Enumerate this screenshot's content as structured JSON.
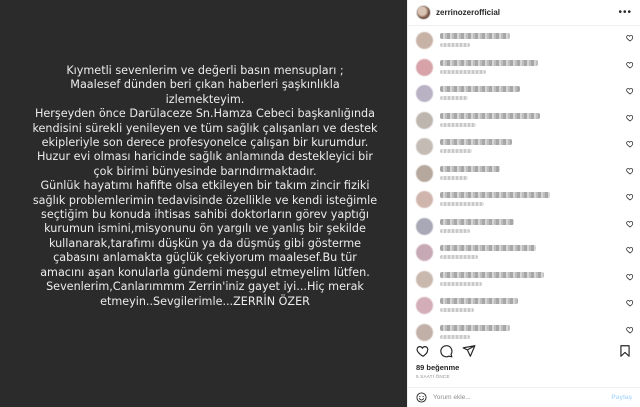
{
  "post": {
    "text_lines": [
      "Kıymetli sevenlerim ve değerli basın mensupları ;",
      "Maalesef dünden beri çıkan haberleri şaşkınlıkla",
      "izlemekteyim.",
      "Herşeyden önce Darülaceze  Sn.Hamza Cebeci başkanlığında",
      "kendisini sürekli yenileyen ve tüm sağlık çalışanları ve destek",
      "ekipleriyle son derece profesyonelce çalışan bir kurumdur.",
      "Huzur evi olması haricinde sağlık anlamında destekleyici bir",
      "çok birimi bünyesinde barındırmaktadır.",
      "Günlük hayatımı hafifte olsa etkileyen bir takım zincir fiziki",
      "sağlık problemlerimin tedavisinde özellikle ve kendi isteğimle",
      "seçtiğim bu konuda ihtisas sahibi doktorların görev yaptığı",
      "kurumun ismini,misyonunu ön yargılı ve yanlış bir şekilde",
      "kullanarak,tarafımı düşkün ya da düşmüş gibi gösterme",
      "çabasını anlamakta güçlük çekiyorum maalesef.Bu tür",
      "amacını aşan  konularla gündemi meşgul etmeyelim lütfen.",
      "Sevenlerim,Canlarımmm Zerrin'iniz gayet iyi...Hiç merak",
      "etmeyin..Sevgilerimle...ZERRİN ÖZER"
    ]
  },
  "header": {
    "username": "zerrinozerofficial",
    "more_icon": "more-horizontal-icon"
  },
  "comments": [
    {
      "text_w": 70,
      "meta_w": 30,
      "avatar_color": "#c7b2a6"
    },
    {
      "text_w": 98,
      "meta_w": 46,
      "avatar_color": "#d7a3a9"
    },
    {
      "text_w": 80,
      "meta_w": 28,
      "avatar_color": "#b9b1c4"
    },
    {
      "text_w": 100,
      "meta_w": 36,
      "avatar_color": "#bdb6ae"
    },
    {
      "text_w": 72,
      "meta_w": 32,
      "avatar_color": "#c4bcb4"
    },
    {
      "text_w": 60,
      "meta_w": 28,
      "avatar_color": "#b6a89d"
    },
    {
      "text_w": 110,
      "meta_w": 44,
      "avatar_color": "#d0b5ad"
    },
    {
      "text_w": 74,
      "meta_w": 30,
      "avatar_color": "#a8a8b6"
    },
    {
      "text_w": 96,
      "meta_w": 38,
      "avatar_color": "#c7a9b5"
    },
    {
      "text_w": 104,
      "meta_w": 42,
      "avatar_color": "#c8b8ae"
    },
    {
      "text_w": 78,
      "meta_w": 34,
      "avatar_color": "#d3aeb9"
    },
    {
      "text_w": 70,
      "meta_w": 30,
      "avatar_color": "#c1b0a7"
    }
  ],
  "actions": {
    "like_icon": "heart-icon",
    "comment_icon": "comment-bubble-icon",
    "share_icon": "paper-plane-icon",
    "save_icon": "bookmark-icon"
  },
  "likes_text": "89 beğenme",
  "time_text": "5 SAATİ ÖNCE",
  "comment_box": {
    "placeholder": "Yorum ekle...",
    "post_label": "Paylaş",
    "emoji_icon": "smiley-icon"
  },
  "colors": {
    "post_bg": "#2b2b2b",
    "post_text": "#ececec",
    "accent_disabled": "#b3dbff"
  }
}
